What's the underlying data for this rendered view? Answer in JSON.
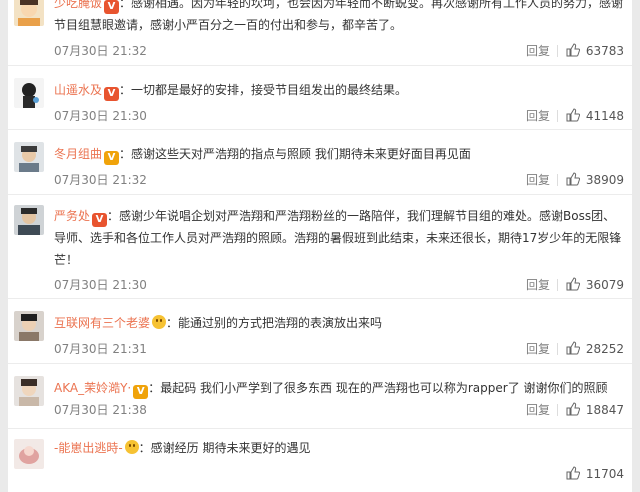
{
  "comments": [
    {
      "username": "少吃腌饭",
      "badge": "V",
      "badge_color": "#e8542f",
      "text": "：感谢相遇。因为年轻的坎坷，也会因为年轻而不断蜕变。再次感谢所有工作人员的努力，感谢节目组慧眼邀请，感谢小严百分之一百的付出和参与，都辛苦了。",
      "timestamp": "07月30日 21:32",
      "reply": "回复",
      "likes": "63783",
      "like_icon": "thumbs-up-icon"
    },
    {
      "username": "山遥水及",
      "badge": "V",
      "badge_color": "#e8542f",
      "text": "：一切都是最好的安排，接受节目组发出的最终结果。",
      "timestamp": "07月30日 21:30",
      "reply": "回复",
      "likes": "41148",
      "like_icon": "thumbs-up-icon"
    },
    {
      "username": "冬月组曲",
      "badge": "V",
      "badge_color": "#f0a30a",
      "text": "：感谢这些天对严浩翔的指点与照顾 我们期待未来更好面目再见面",
      "timestamp": "07月30日 21:32",
      "reply": "回复",
      "likes": "38909",
      "like_icon": "thumbs-up-icon"
    },
    {
      "username": "严务处",
      "badge": "V",
      "badge_color": "#e8542f",
      "text": "：感谢少年说唱企划对严浩翔和严浩翔粉丝的一路陪伴，我们理解节目组的难处。感谢Boss团、导师、选手和各位工作人员对严浩翔的照顾。浩翔的暑假班到此结束，未来还很长，期待17岁少年的无限锋芒！",
      "timestamp": "07月30日 21:30",
      "reply": "回复",
      "likes": "36079",
      "like_icon": "thumbs-up-icon"
    },
    {
      "username": "互联网有三个老婆",
      "badge": "emoji",
      "badge_color": "#f6c233",
      "text": "：能通过别的方式把浩翔的表演放出来吗",
      "timestamp": "07月30日 21:31",
      "reply": "回复",
      "likes": "28252",
      "like_icon": "thumbs-up-icon"
    },
    {
      "username": "AKA_茉姈澔Y·",
      "badge": "V",
      "badge_color": "#f0a30a",
      "text": "：最起码 我们小严学到了很多东西 现在的严浩翔也可以称为rapper了 谢谢你们的照顾",
      "timestamp": "07月30日 21:38",
      "reply": "回复",
      "likes": "18847",
      "like_icon": "thumbs-up-icon"
    },
    {
      "username": "-能崽出逃時-",
      "badge": "emoji",
      "badge_color": "#f6c233",
      "text": "：感谢经历 期待未来更好的遇见",
      "timestamp": "",
      "reply": "",
      "likes": "11704",
      "like_icon": "thumbs-up-icon"
    }
  ]
}
